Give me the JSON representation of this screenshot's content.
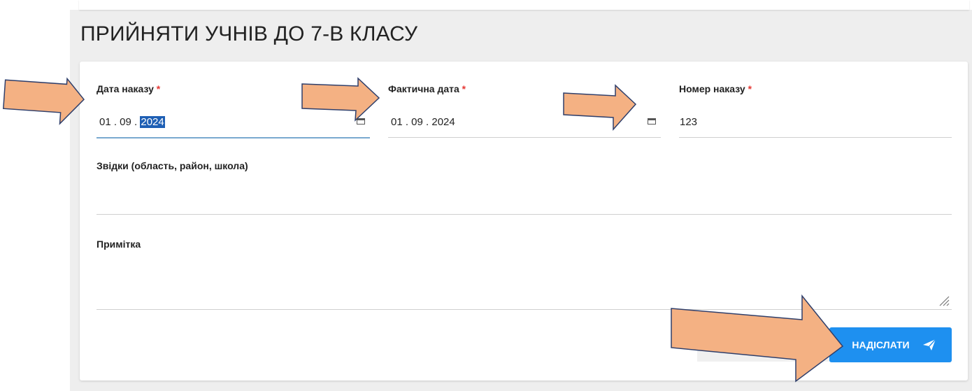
{
  "form": {
    "title": "ПРИЙНЯТИ УЧНІВ ДО 7-В КЛАСУ",
    "required_mark": "*",
    "order_date": {
      "label": "Дата наказу",
      "day_month": "01 . 09 . ",
      "year": "2024"
    },
    "actual_date": {
      "label": "Фактична дата",
      "value": "01 . 09 . 2024"
    },
    "order_number": {
      "label": "Номер наказу",
      "value": "123"
    },
    "from": {
      "label": "Звідки (область, район, школа)",
      "value": ""
    },
    "note": {
      "label": "Примітка",
      "value": ""
    },
    "submit_label": "НАДІСЛАТИ"
  },
  "colors": {
    "accent": "#1e90f0",
    "required": "#e53935",
    "arrow_fill": "#f4b183",
    "arrow_stroke": "#2f3f6b"
  }
}
